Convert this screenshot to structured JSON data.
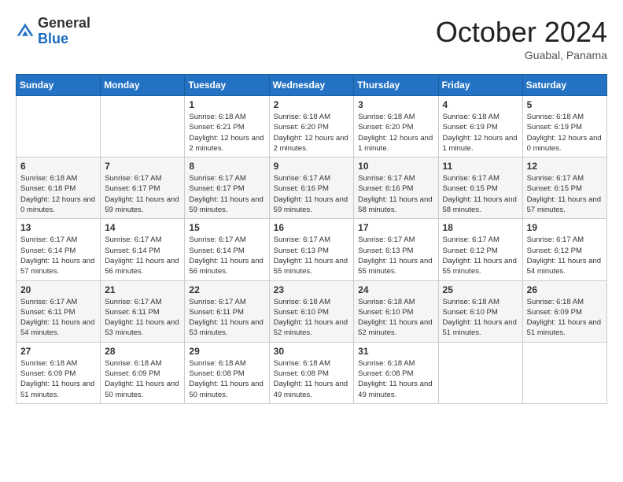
{
  "header": {
    "logo_general": "General",
    "logo_blue": "Blue",
    "month_year": "October 2024",
    "location": "Guabal, Panama"
  },
  "days_of_week": [
    "Sunday",
    "Monday",
    "Tuesday",
    "Wednesday",
    "Thursday",
    "Friday",
    "Saturday"
  ],
  "weeks": [
    [
      {
        "day": null
      },
      {
        "day": null
      },
      {
        "day": 1,
        "sunrise": "Sunrise: 6:18 AM",
        "sunset": "Sunset: 6:21 PM",
        "daylight": "Daylight: 12 hours and 2 minutes."
      },
      {
        "day": 2,
        "sunrise": "Sunrise: 6:18 AM",
        "sunset": "Sunset: 6:20 PM",
        "daylight": "Daylight: 12 hours and 2 minutes."
      },
      {
        "day": 3,
        "sunrise": "Sunrise: 6:18 AM",
        "sunset": "Sunset: 6:20 PM",
        "daylight": "Daylight: 12 hours and 1 minute."
      },
      {
        "day": 4,
        "sunrise": "Sunrise: 6:18 AM",
        "sunset": "Sunset: 6:19 PM",
        "daylight": "Daylight: 12 hours and 1 minute."
      },
      {
        "day": 5,
        "sunrise": "Sunrise: 6:18 AM",
        "sunset": "Sunset: 6:19 PM",
        "daylight": "Daylight: 12 hours and 0 minutes."
      }
    ],
    [
      {
        "day": 6,
        "sunrise": "Sunrise: 6:18 AM",
        "sunset": "Sunset: 6:18 PM",
        "daylight": "Daylight: 12 hours and 0 minutes."
      },
      {
        "day": 7,
        "sunrise": "Sunrise: 6:17 AM",
        "sunset": "Sunset: 6:17 PM",
        "daylight": "Daylight: 11 hours and 59 minutes."
      },
      {
        "day": 8,
        "sunrise": "Sunrise: 6:17 AM",
        "sunset": "Sunset: 6:17 PM",
        "daylight": "Daylight: 11 hours and 59 minutes."
      },
      {
        "day": 9,
        "sunrise": "Sunrise: 6:17 AM",
        "sunset": "Sunset: 6:16 PM",
        "daylight": "Daylight: 11 hours and 59 minutes."
      },
      {
        "day": 10,
        "sunrise": "Sunrise: 6:17 AM",
        "sunset": "Sunset: 6:16 PM",
        "daylight": "Daylight: 11 hours and 58 minutes."
      },
      {
        "day": 11,
        "sunrise": "Sunrise: 6:17 AM",
        "sunset": "Sunset: 6:15 PM",
        "daylight": "Daylight: 11 hours and 58 minutes."
      },
      {
        "day": 12,
        "sunrise": "Sunrise: 6:17 AM",
        "sunset": "Sunset: 6:15 PM",
        "daylight": "Daylight: 11 hours and 57 minutes."
      }
    ],
    [
      {
        "day": 13,
        "sunrise": "Sunrise: 6:17 AM",
        "sunset": "Sunset: 6:14 PM",
        "daylight": "Daylight: 11 hours and 57 minutes."
      },
      {
        "day": 14,
        "sunrise": "Sunrise: 6:17 AM",
        "sunset": "Sunset: 6:14 PM",
        "daylight": "Daylight: 11 hours and 56 minutes."
      },
      {
        "day": 15,
        "sunrise": "Sunrise: 6:17 AM",
        "sunset": "Sunset: 6:14 PM",
        "daylight": "Daylight: 11 hours and 56 minutes."
      },
      {
        "day": 16,
        "sunrise": "Sunrise: 6:17 AM",
        "sunset": "Sunset: 6:13 PM",
        "daylight": "Daylight: 11 hours and 55 minutes."
      },
      {
        "day": 17,
        "sunrise": "Sunrise: 6:17 AM",
        "sunset": "Sunset: 6:13 PM",
        "daylight": "Daylight: 11 hours and 55 minutes."
      },
      {
        "day": 18,
        "sunrise": "Sunrise: 6:17 AM",
        "sunset": "Sunset: 6:12 PM",
        "daylight": "Daylight: 11 hours and 55 minutes."
      },
      {
        "day": 19,
        "sunrise": "Sunrise: 6:17 AM",
        "sunset": "Sunset: 6:12 PM",
        "daylight": "Daylight: 11 hours and 54 minutes."
      }
    ],
    [
      {
        "day": 20,
        "sunrise": "Sunrise: 6:17 AM",
        "sunset": "Sunset: 6:11 PM",
        "daylight": "Daylight: 11 hours and 54 minutes."
      },
      {
        "day": 21,
        "sunrise": "Sunrise: 6:17 AM",
        "sunset": "Sunset: 6:11 PM",
        "daylight": "Daylight: 11 hours and 53 minutes."
      },
      {
        "day": 22,
        "sunrise": "Sunrise: 6:17 AM",
        "sunset": "Sunset: 6:11 PM",
        "daylight": "Daylight: 11 hours and 53 minutes."
      },
      {
        "day": 23,
        "sunrise": "Sunrise: 6:18 AM",
        "sunset": "Sunset: 6:10 PM",
        "daylight": "Daylight: 11 hours and 52 minutes."
      },
      {
        "day": 24,
        "sunrise": "Sunrise: 6:18 AM",
        "sunset": "Sunset: 6:10 PM",
        "daylight": "Daylight: 11 hours and 52 minutes."
      },
      {
        "day": 25,
        "sunrise": "Sunrise: 6:18 AM",
        "sunset": "Sunset: 6:10 PM",
        "daylight": "Daylight: 11 hours and 51 minutes."
      },
      {
        "day": 26,
        "sunrise": "Sunrise: 6:18 AM",
        "sunset": "Sunset: 6:09 PM",
        "daylight": "Daylight: 11 hours and 51 minutes."
      }
    ],
    [
      {
        "day": 27,
        "sunrise": "Sunrise: 6:18 AM",
        "sunset": "Sunset: 6:09 PM",
        "daylight": "Daylight: 11 hours and 51 minutes."
      },
      {
        "day": 28,
        "sunrise": "Sunrise: 6:18 AM",
        "sunset": "Sunset: 6:09 PM",
        "daylight": "Daylight: 11 hours and 50 minutes."
      },
      {
        "day": 29,
        "sunrise": "Sunrise: 6:18 AM",
        "sunset": "Sunset: 6:08 PM",
        "daylight": "Daylight: 11 hours and 50 minutes."
      },
      {
        "day": 30,
        "sunrise": "Sunrise: 6:18 AM",
        "sunset": "Sunset: 6:08 PM",
        "daylight": "Daylight: 11 hours and 49 minutes."
      },
      {
        "day": 31,
        "sunrise": "Sunrise: 6:18 AM",
        "sunset": "Sunset: 6:08 PM",
        "daylight": "Daylight: 11 hours and 49 minutes."
      },
      {
        "day": null
      },
      {
        "day": null
      }
    ]
  ]
}
